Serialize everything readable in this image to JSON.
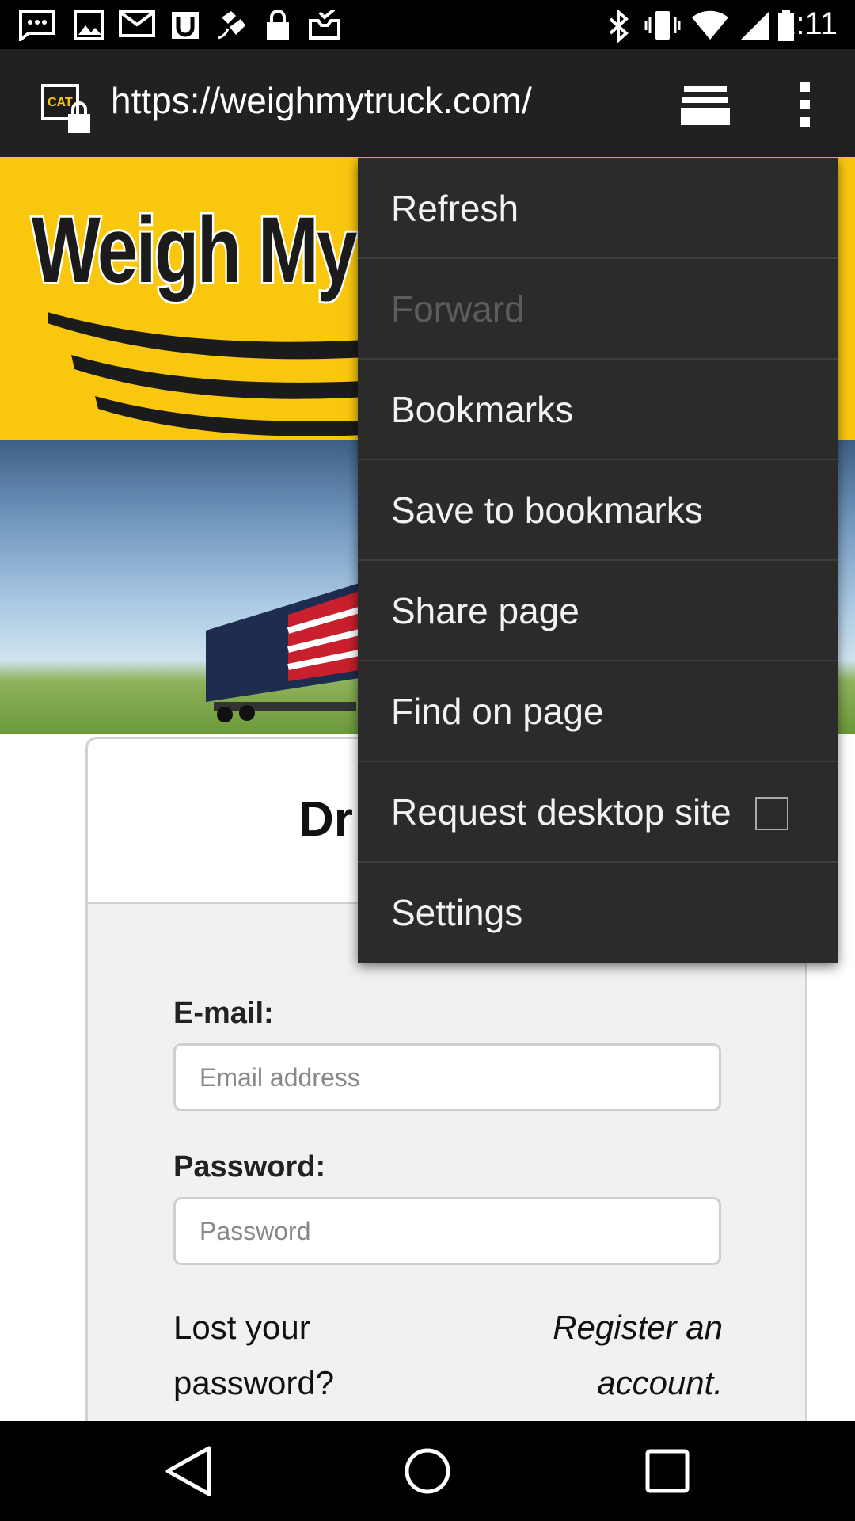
{
  "status_bar": {
    "time": "2:11",
    "icons": [
      "messages-icon",
      "image-icon",
      "email-icon",
      "ublock-icon",
      "fake-gps-icon",
      "lock-icon",
      "inbox-icon",
      "bluetooth-icon",
      "vibrate-icon",
      "wifi-icon",
      "signal-icon",
      "battery-icon"
    ]
  },
  "browser": {
    "url": "https://weighmytruck.com/",
    "menu": {
      "items": [
        {
          "label": "Refresh",
          "enabled": true
        },
        {
          "label": "Forward",
          "enabled": false
        },
        {
          "label": "Bookmarks",
          "enabled": true
        },
        {
          "label": "Save to bookmarks",
          "enabled": true
        },
        {
          "label": "Share page",
          "enabled": true
        },
        {
          "label": "Find on page",
          "enabled": true
        },
        {
          "label": "Request desktop site",
          "enabled": true,
          "checked": false
        },
        {
          "label": "Settings",
          "enabled": true
        }
      ]
    }
  },
  "page": {
    "logo_text": "Weigh My T",
    "card_title": "Dr",
    "email_label": "E-mail:",
    "email_placeholder": "Email address",
    "password_label": "Password:",
    "password_placeholder": "Password",
    "lost_password": "Lost your password?",
    "register": "Register an account."
  },
  "colors": {
    "banner_yellow": "#f9c80e",
    "menu_bg": "#2b2b2b",
    "url_bar_bg": "#212121"
  },
  "nav": [
    "back-icon",
    "home-icon",
    "recents-icon"
  ]
}
